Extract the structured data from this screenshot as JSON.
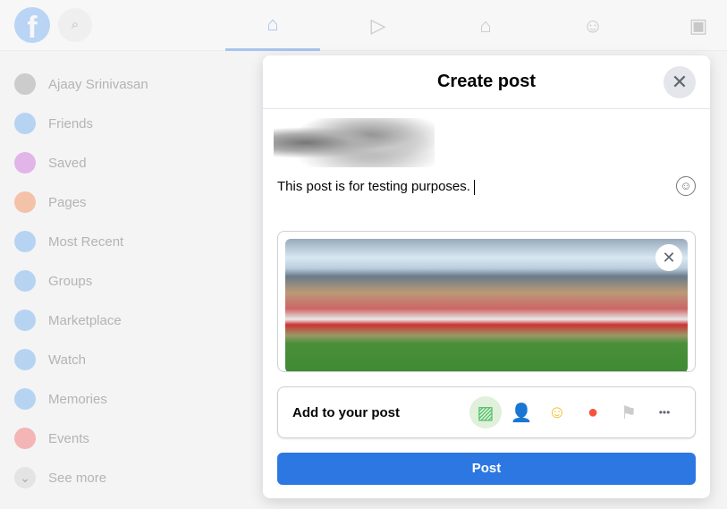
{
  "topbar": {
    "logo": "f",
    "nav": [
      {
        "name": "home",
        "icon": "⌂",
        "active": true
      },
      {
        "name": "watch",
        "icon": "▶"
      },
      {
        "name": "marketplace",
        "icon": "⌂"
      },
      {
        "name": "groups",
        "icon": "☺"
      },
      {
        "name": "gaming",
        "icon": "▣"
      }
    ]
  },
  "sidebar": {
    "items": [
      {
        "label": "Ajaay Srinivasan",
        "icon": "avatar",
        "color": "#ccc"
      },
      {
        "label": "Friends",
        "icon": "friends-icon",
        "color": "#b7d3f2"
      },
      {
        "label": "Saved",
        "icon": "bookmark-icon",
        "color": "#e2b5e8"
      },
      {
        "label": "Pages",
        "icon": "flag-icon",
        "color": "#f3c2a8"
      },
      {
        "label": "Most Recent",
        "icon": "clock-feed-icon",
        "color": "#b7d3f2"
      },
      {
        "label": "Groups",
        "icon": "groups-icon",
        "color": "#b7d3f2"
      },
      {
        "label": "Marketplace",
        "icon": "shop-icon",
        "color": "#b7d3f2"
      },
      {
        "label": "Watch",
        "icon": "play-icon",
        "color": "#b7d3f2"
      },
      {
        "label": "Memories",
        "icon": "memories-icon",
        "color": "#b7d3f2"
      },
      {
        "label": "Events",
        "icon": "calendar-icon",
        "color": "#f3b5b5"
      },
      {
        "label": "See more",
        "icon": "chevron-down-icon",
        "color": "#e4e4e4"
      }
    ]
  },
  "modal": {
    "title": "Create post",
    "post_text": "This post is for testing purposes.",
    "add_label": "Add to your post",
    "post_button": "Post",
    "tools": [
      {
        "name": "photo-video-icon",
        "glyph": "▨",
        "color": "#45bd62",
        "bg": "#e0f0da"
      },
      {
        "name": "tag-people-icon",
        "glyph": "👤",
        "color": "#1877f2"
      },
      {
        "name": "feeling-icon",
        "glyph": "☺",
        "color": "#f7b928"
      },
      {
        "name": "check-in-icon",
        "glyph": "●",
        "color": "#f5533d"
      },
      {
        "name": "flag-icon",
        "glyph": "⚑",
        "color": "#ccc"
      },
      {
        "name": "more-icon",
        "glyph": "•••",
        "color": "#606770"
      }
    ]
  }
}
